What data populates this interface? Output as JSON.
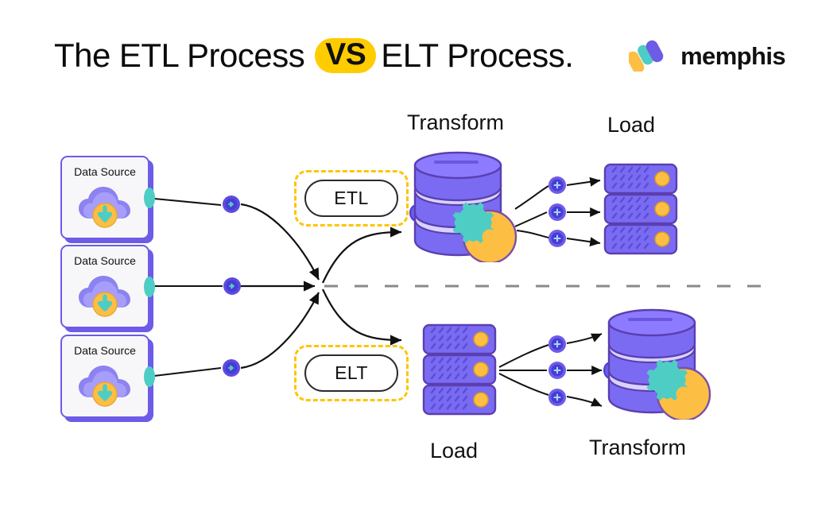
{
  "header": {
    "title_part1": "The",
    "title_part2": "ETL Process",
    "title_vs": "VS",
    "title_part3": "ELT Process.",
    "logo_text": "memphis",
    "logo_mark_name": "memphis-logo-mark"
  },
  "colors": {
    "accent_yellow": "#FFCC00",
    "gold": "#FFC400",
    "purple": "#6c5ce7",
    "purple_deep": "#5b4de0",
    "purple_light": "#8d7bff",
    "lavender_band": "#d9d2ff",
    "teal": "#4ecdc4",
    "gear_orange": "#FDBE44",
    "card_bg": "#f7f7f9",
    "text": "#111111",
    "divider_gray": "#8a8a8a"
  },
  "sources": [
    {
      "label": "Data Source",
      "icon": "cloud-download-icon"
    },
    {
      "label": "Data Source",
      "icon": "cloud-download-icon"
    },
    {
      "label": "Data Source",
      "icon": "cloud-download-icon"
    }
  ],
  "flows": {
    "etl": {
      "badge": "ETL",
      "stage_1_label": "Transform",
      "stage_1_icon": "database-gear-icon",
      "stage_2_label": "Load",
      "stage_2_icon": "server-rack-icon"
    },
    "elt": {
      "badge": "ELT",
      "stage_1_label": "Load",
      "stage_1_icon": "server-rack-icon",
      "stage_2_label": "Transform",
      "stage_2_icon": "database-gear-icon"
    }
  },
  "connectors": {
    "source_node_icon": "flow-node-icon",
    "fanout_node_icon": "flow-node-icon",
    "count_source_nodes": 3,
    "count_fanout_nodes_top": 3,
    "count_fanout_nodes_bottom": 3
  },
  "divider": {
    "name": "dashed-separator",
    "style": "dashed"
  }
}
